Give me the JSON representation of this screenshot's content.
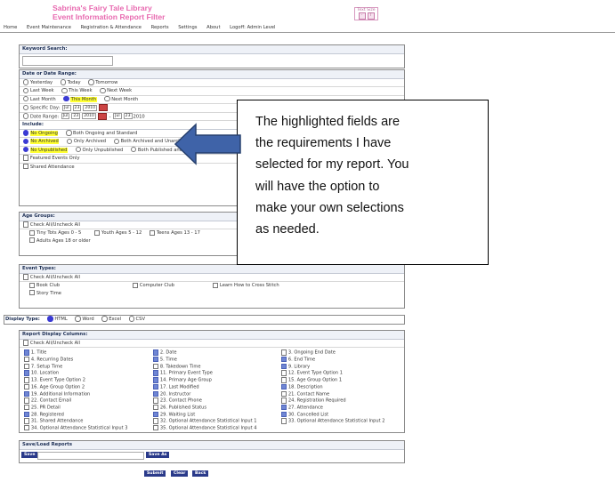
{
  "header": {
    "title_line1": "Sabrina's Fairy Tale Library",
    "title_line2": "Event Information Report Filter",
    "text_size_label": "Text Size",
    "text_size_minus": "-",
    "text_size_plus": "T",
    "text_size_plus2": "T"
  },
  "nav": [
    "Home",
    "Event Maintenance",
    "Registration & Attendance",
    "Reports",
    "Settings",
    "About",
    "Logoff: Admin Level"
  ],
  "keyword": {
    "label": "Keyword Search:"
  },
  "date": {
    "label": "Date or Date Range:",
    "row1": [
      "Yesterday",
      "Today",
      "Tomorrow"
    ],
    "row2": [
      "Last Week",
      "This Week",
      "Next Week"
    ],
    "row3": [
      "Last Month",
      "This Month",
      "Next Month"
    ],
    "specific_day": "Specific Day:",
    "date_range": "Date Range:",
    "month": "Jul",
    "day": "23",
    "year": "2010",
    "dash": "-"
  },
  "include": {
    "label": "Include:",
    "ongoing": [
      "No Ongoing",
      "Both Ongoing and Standard"
    ],
    "archived": [
      "No Archived",
      "Only Archived",
      "Both Archived and Unarchived"
    ],
    "published": [
      "No Unpublished",
      "Only Unpublished",
      "Both Published and Unpublished"
    ],
    "featured": "Featured Events Only",
    "shared": "Shared Attendance"
  },
  "age": {
    "label": "Age Groups:",
    "check_all": "Check All/Uncheck All",
    "items": [
      "Tiny Tots Ages 0 - 5",
      "Youth Ages 5 - 12",
      "Teens Ages 13 - 17",
      "Adults Ages 18 or older"
    ]
  },
  "event_types": {
    "label": "Event Types:",
    "check_all": "Check All/Uncheck All",
    "items": [
      "Book Club",
      "Computer Club",
      "Learn How to Cross Stitch",
      "Story Time"
    ]
  },
  "display_type": {
    "label": "Display Type:",
    "options": [
      "HTML",
      "Word",
      "Excel",
      "CSV"
    ]
  },
  "columns": {
    "label": "Report Display Columns:",
    "check_all": "Check All/Uncheck All",
    "col1": [
      {
        "t": "1. Title",
        "c": true
      },
      {
        "t": "4. Recurring Dates",
        "c": false
      },
      {
        "t": "7. Setup Time",
        "c": false
      },
      {
        "t": "10. Location",
        "c": true
      },
      {
        "t": "13. Event Type Option 2",
        "c": false
      },
      {
        "t": "16. Age Group Option 2",
        "c": false
      },
      {
        "t": "19. Additional Information",
        "c": true
      },
      {
        "t": "22. Contact Email",
        "c": false
      },
      {
        "t": "25. PR Detail",
        "c": false
      },
      {
        "t": "28. Registered",
        "c": true
      },
      {
        "t": "31. Shared Attendance",
        "c": false
      },
      {
        "t": "34. Optional Attendance Statistical Input 3",
        "c": false
      }
    ],
    "col2": [
      {
        "t": "2. Date",
        "c": true
      },
      {
        "t": "5. Time",
        "c": true
      },
      {
        "t": "8. Takedown Time",
        "c": false
      },
      {
        "t": "11. Primary Event Type",
        "c": true
      },
      {
        "t": "14. Primary Age Group",
        "c": true
      },
      {
        "t": "17. Last Modified",
        "c": true
      },
      {
        "t": "20. Instructor",
        "c": true
      },
      {
        "t": "23. Contact Phone",
        "c": false
      },
      {
        "t": "26. Published Status",
        "c": false
      },
      {
        "t": "29. Waiting List",
        "c": true
      },
      {
        "t": "32. Optional Attendance Statistical Input 1",
        "c": false
      },
      {
        "t": "35. Optional Attendance Statistical Input 4",
        "c": false
      }
    ],
    "col3": [
      {
        "t": "3. Ongoing End Date",
        "c": false
      },
      {
        "t": "6. End Time",
        "c": true
      },
      {
        "t": "9. Library",
        "c": true
      },
      {
        "t": "12. Event Type Option 1",
        "c": false
      },
      {
        "t": "15. Age Group Option 1",
        "c": false
      },
      {
        "t": "18. Description",
        "c": true
      },
      {
        "t": "21. Contact Name",
        "c": false
      },
      {
        "t": "24. Registration Required",
        "c": false
      },
      {
        "t": "27. Attendance",
        "c": true
      },
      {
        "t": "30. Cancelled List",
        "c": true
      },
      {
        "t": "33. Optional Attendance Statistical Input 2",
        "c": false
      }
    ]
  },
  "saveload": {
    "label": "Save/Load Reports",
    "save": "Save",
    "save_as": "Save As"
  },
  "bottom_buttons": [
    "Submit",
    "Clear",
    "Back"
  ],
  "callout": {
    "lines": [
      "The highlighted fields are",
      "the requirements I have",
      "selected for my report.  You",
      "will have the option to",
      "make your own selections",
      "as needed."
    ]
  },
  "colors": {
    "title_pink": "#e86ab0",
    "highlight": "#ffff33",
    "button_blue": "#2a3a8a",
    "arrow_blue": "#3f63a8"
  }
}
